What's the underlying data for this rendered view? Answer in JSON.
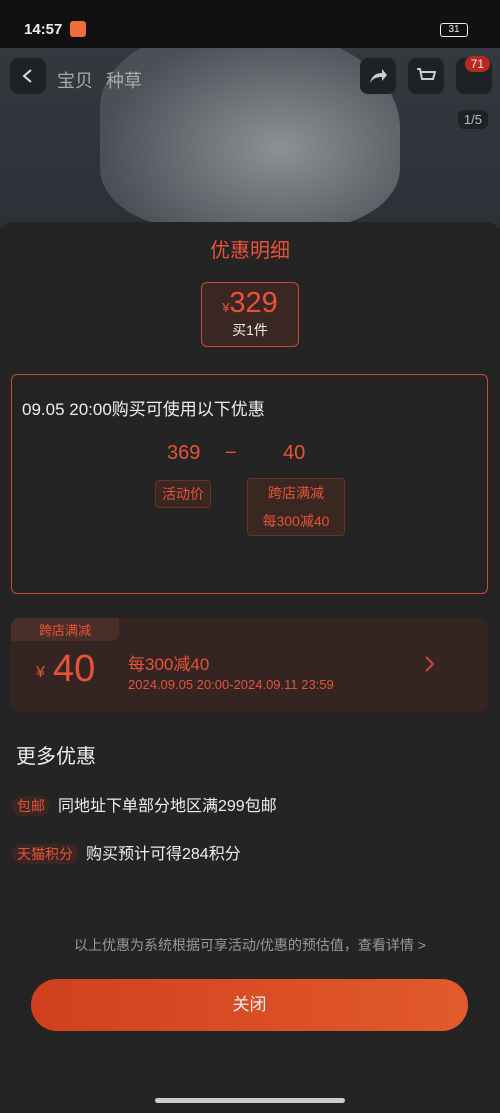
{
  "status": {
    "time": "14:57",
    "battery": "31"
  },
  "product": {
    "tab_item": "宝贝",
    "tab_grass": "种草",
    "badge": "71",
    "counter": "1/5"
  },
  "sheet": {
    "title": "优惠明细",
    "price_symbol": "¥",
    "price": "329",
    "qty": "买1件",
    "card_title": "09.05 20:00购买可使用以下优惠",
    "price_a": "369",
    "minus": "−",
    "price_b": "40",
    "label_a": "活动价",
    "label_b1": "跨店满减",
    "label_b2": "每300减40"
  },
  "coupon": {
    "tag": "跨店满减",
    "symbol": "¥",
    "amount": "40",
    "rule": "每300减40",
    "period": "2024.09.05 20:00-2024.09.11 23:59"
  },
  "more": {
    "title": "更多优惠",
    "items": [
      {
        "tag": "包邮",
        "text": "同地址下单部分地区满299包邮"
      },
      {
        "tag": "天猫积分",
        "text": "购买预计可得284积分"
      }
    ]
  },
  "footer": {
    "note": "以上优惠为系统根据可享活动/优惠的预估值，查看详情 >",
    "close": "关闭"
  },
  "colors": {
    "accent": "#e8523a"
  }
}
